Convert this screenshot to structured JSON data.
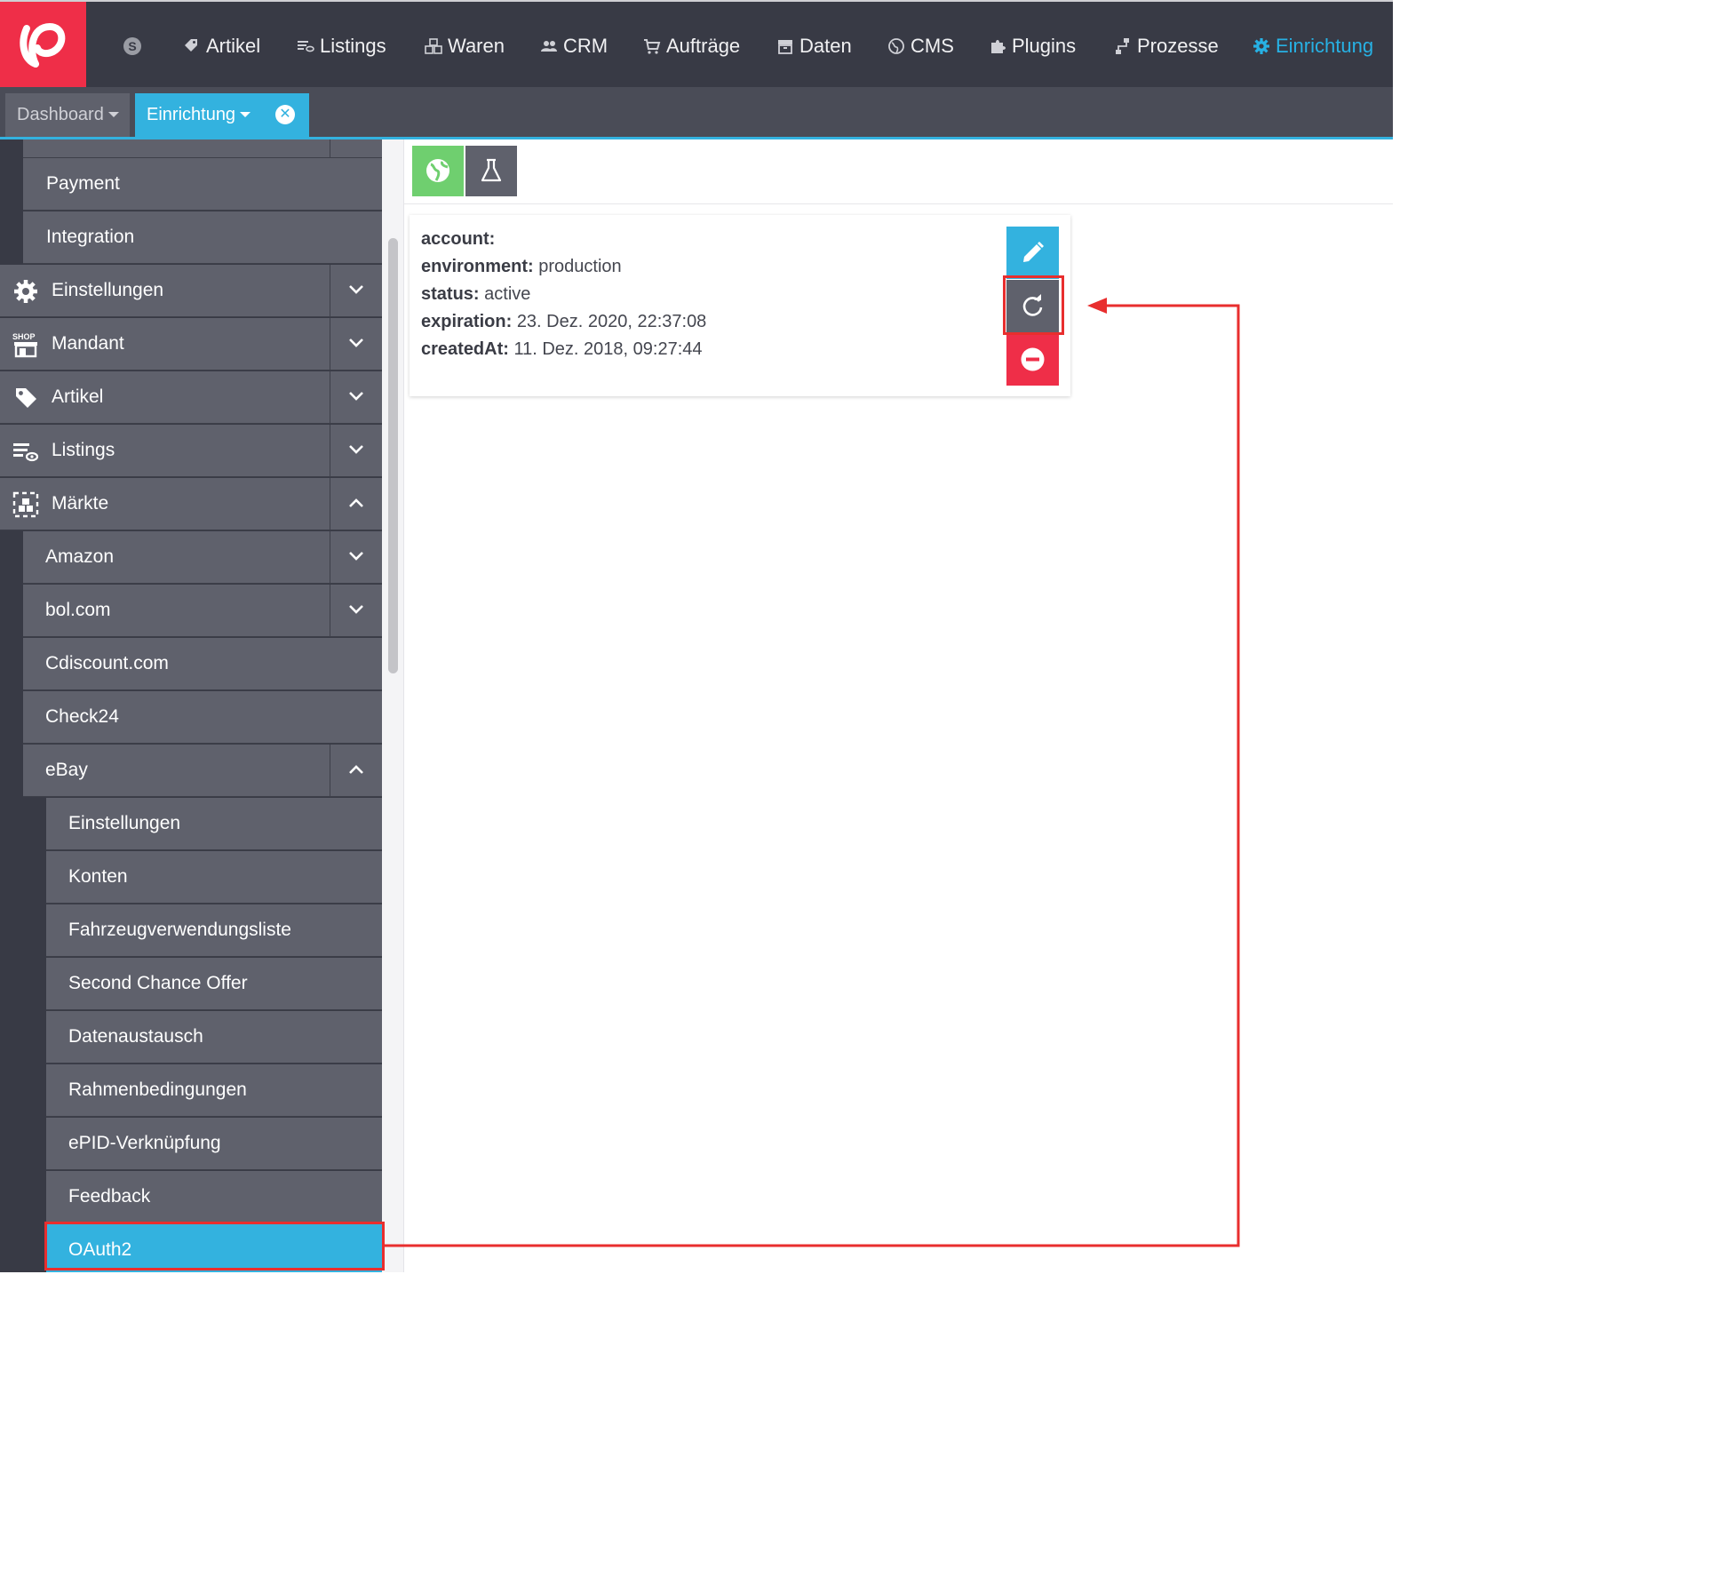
{
  "nav": {
    "items": [
      {
        "label": "Artikel",
        "icon": "tag-icon"
      },
      {
        "label": "Listings",
        "icon": "listings-icon"
      },
      {
        "label": "Waren",
        "icon": "boxes-icon"
      },
      {
        "label": "CRM",
        "icon": "people-icon"
      },
      {
        "label": "Aufträge",
        "icon": "cart-icon"
      },
      {
        "label": "Daten",
        "icon": "archive-icon"
      },
      {
        "label": "CMS",
        "icon": "globe-icon"
      },
      {
        "label": "Plugins",
        "icon": "puzzle-icon"
      },
      {
        "label": "Prozesse",
        "icon": "process-icon"
      },
      {
        "label": "Einrichtung",
        "icon": "gear-icon"
      }
    ],
    "s_badge": "S",
    "active_color": "#27b1e4"
  },
  "tabs": {
    "dashboard": "Dashboard",
    "einrichtung": "Einrichtung",
    "close_glyph": "✕"
  },
  "sidebar": {
    "payment": "Payment",
    "integration": "Integration",
    "einstellungen": "Einstellungen",
    "mandant": "Mandant",
    "mandant_icon_text": "SHOP",
    "artikel": "Artikel",
    "listings": "Listings",
    "maerkte": "Märkte",
    "amazon": "Amazon",
    "bol": "bol.com",
    "cdiscount": "Cdiscount.com",
    "check24": "Check24",
    "ebay": "eBay",
    "ebay_items": {
      "einstellungen": "Einstellungen",
      "konten": "Konten",
      "fahrzeug": "Fahrzeugverwendungsliste",
      "second_chance": "Second Chance Offer",
      "datenaustausch": "Datenaustausch",
      "rahmen": "Rahmenbedingungen",
      "epid": "ePID-Verknüpfung",
      "feedback": "Feedback",
      "oauth2": "OAuth2"
    }
  },
  "card": {
    "account_label": "account:",
    "account_value": "",
    "environment_label": "environment:",
    "environment_value": "production",
    "status_label": "status:",
    "status_value": "active",
    "expiration_label": "expiration:",
    "expiration_value": "23. Dez. 2020, 22:37:08",
    "created_label": "createdAt:",
    "created_value": "11. Dez. 2018, 09:27:44"
  },
  "colors": {
    "brand": "#ef2e48",
    "accent": "#33b2df",
    "sidebar": "#5f616c",
    "highlight": "#e82e2e",
    "success": "#6fcf6f"
  }
}
